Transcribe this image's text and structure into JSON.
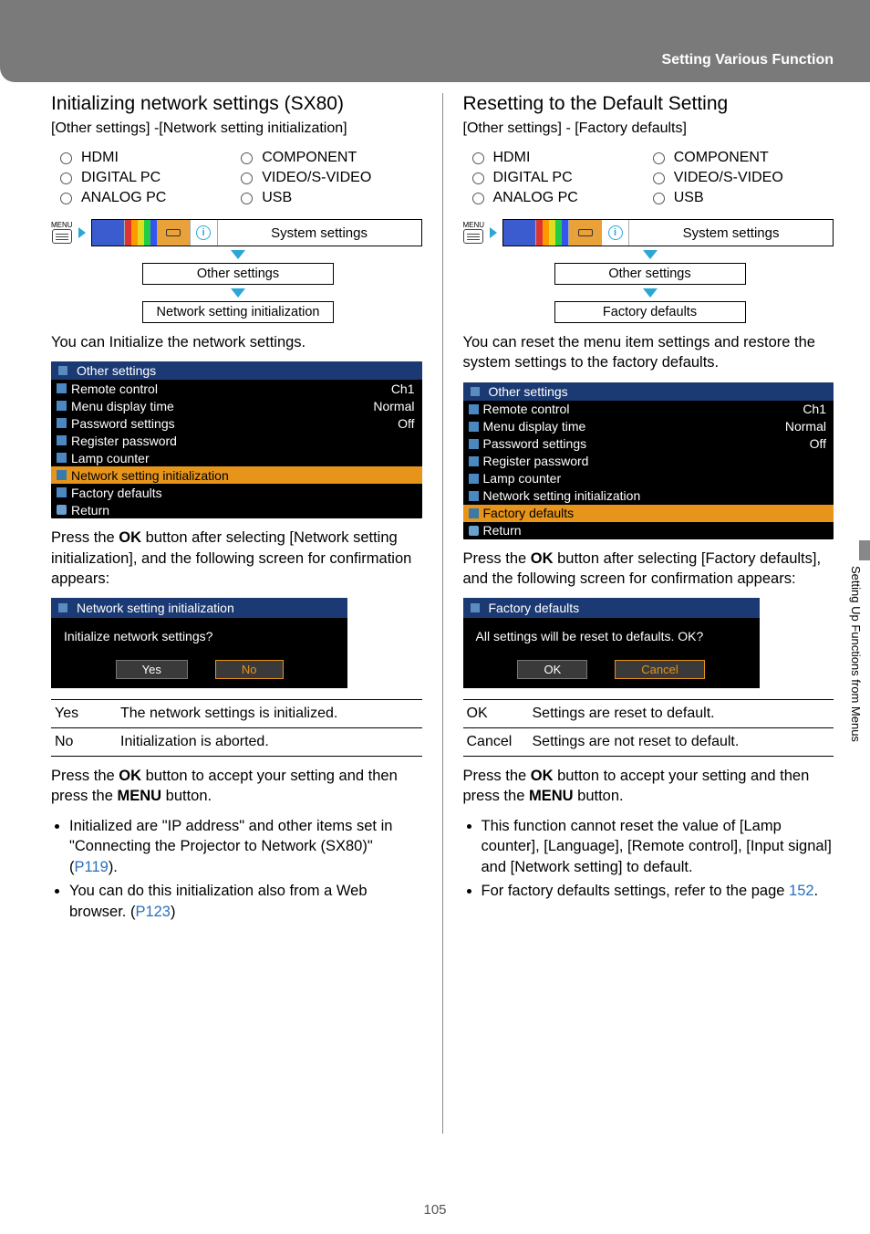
{
  "header": {
    "title": "Setting Various Function"
  },
  "side_tab": "Setting Up Functions from Menus",
  "page_number": "105",
  "inputs": [
    "HDMI",
    "DIGITAL PC",
    "ANALOG PC",
    "COMPONENT",
    "VIDEO/S-VIDEO",
    "USB"
  ],
  "nav": {
    "system_settings": "System settings",
    "other_settings": "Other settings",
    "menu_label": "MENU"
  },
  "left": {
    "title": "Initializing network settings (SX80)",
    "path": "[Other settings] -[Network setting initialization]",
    "nav_leaf": "Network setting initialization",
    "para1": "You can Initialize the network settings.",
    "menu_title": "Other settings",
    "menu_rows": [
      {
        "label": "Remote control",
        "value": "Ch1"
      },
      {
        "label": "Menu display time",
        "value": "Normal"
      },
      {
        "label": "Password settings",
        "value": "Off"
      },
      {
        "label": "Register password",
        "value": ""
      },
      {
        "label": "Lamp counter",
        "value": ""
      },
      {
        "label": "Network setting initialization",
        "value": "",
        "hl": true
      },
      {
        "label": "Factory defaults",
        "value": ""
      },
      {
        "label": "Return",
        "value": "",
        "ret": true
      }
    ],
    "para2a": "Press the ",
    "para2b": " button after selecting [Network setting initialization], and the following screen for confirmation appears:",
    "ok_word": "OK",
    "dialog_title": "Network setting initialization",
    "dialog_body": "Initialize network settings?",
    "dialog_yes": "Yes",
    "dialog_no": "No",
    "table": [
      {
        "k": "Yes",
        "v": "The network settings is initialized."
      },
      {
        "k": "No",
        "v": "Initialization is aborted."
      }
    ],
    "para3a": "Press the ",
    "para3b": " button to accept your setting and then press the ",
    "para3c": " button.",
    "menu_word": "MENU",
    "bullets": [
      {
        "pre": "Initialized are \"IP address\" and other items set in \"Connecting the Projector to Network (SX80)\" (",
        "link": "P119",
        "post": ")."
      },
      {
        "pre": "You can do this initialization also from a Web browser. (",
        "link": "P123",
        "post": ")"
      }
    ]
  },
  "right": {
    "title": "Resetting to the Default Setting",
    "path": "[Other settings] - [Factory defaults]",
    "nav_leaf": "Factory defaults",
    "para1": "You can reset the menu item settings and restore the system settings to the factory defaults.",
    "menu_title": "Other settings",
    "menu_rows": [
      {
        "label": "Remote control",
        "value": "Ch1"
      },
      {
        "label": "Menu display time",
        "value": "Normal"
      },
      {
        "label": "Password settings",
        "value": "Off"
      },
      {
        "label": "Register password",
        "value": ""
      },
      {
        "label": "Lamp counter",
        "value": ""
      },
      {
        "label": "Network setting initialization",
        "value": ""
      },
      {
        "label": "Factory defaults",
        "value": "",
        "hl": true
      },
      {
        "label": "Return",
        "value": "",
        "ret": true
      }
    ],
    "para2a": "Press the ",
    "para2b": " button after selecting [Factory defaults], and the following screen for confirmation appears:",
    "ok_word": "OK",
    "dialog_title": "Factory defaults",
    "dialog_body": "All settings will be reset to defaults. OK?",
    "dialog_ok": "OK",
    "dialog_cancel": "Cancel",
    "table": [
      {
        "k": "OK",
        "v": "Settings are reset to default."
      },
      {
        "k": "Cancel",
        "v": "Settings are not reset to default."
      }
    ],
    "para3a": "Press the ",
    "para3b": " button to accept your setting and then press the ",
    "para3c": " button.",
    "menu_word": "MENU",
    "bullets": [
      {
        "text": "This function cannot reset the value of [Lamp counter], [Language], [Remote control], [Input signal] and [Network setting] to default."
      },
      {
        "pre": "For factory defaults settings, refer to the page ",
        "link": "152",
        "post": "."
      }
    ]
  }
}
